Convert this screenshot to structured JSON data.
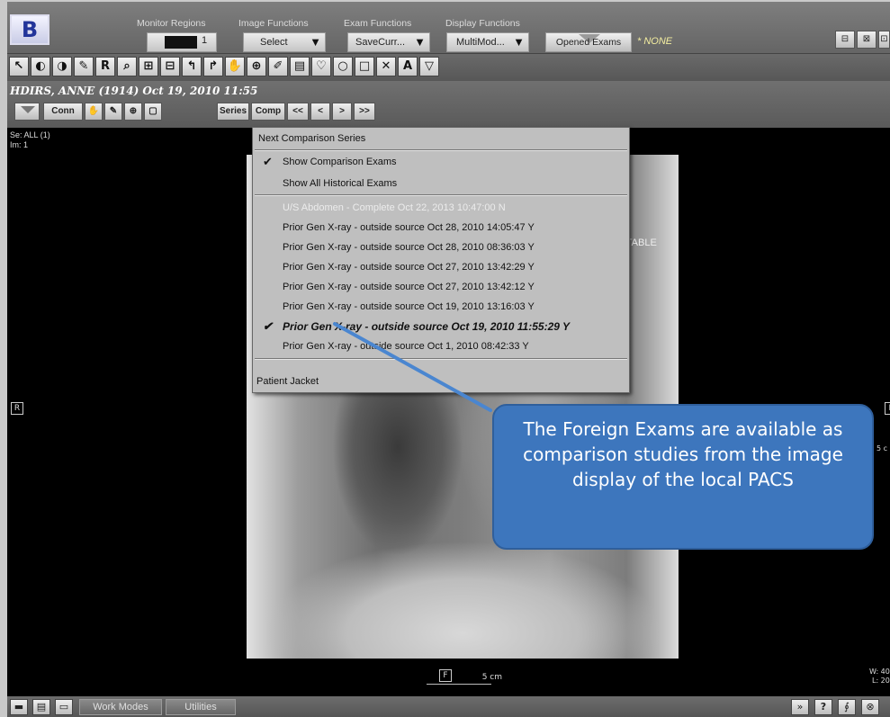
{
  "app": {
    "logo": "B"
  },
  "toolbar": {
    "monitor_regions_label": "Monitor Regions",
    "monitor_value": "1",
    "image_functions_label": "Image Functions",
    "image_functions_value": "Select",
    "exam_functions_label": "Exam Functions",
    "exam_functions_value": "SaveCurr...",
    "display_functions_label": "Display Functions",
    "display_functions_value": "MultiMod...",
    "opened_exams_label": "Opened Exams",
    "opened_exams_status": "* NONE",
    "dropdown_arrow": "▼"
  },
  "window_buttons": [
    "⊟",
    "⊠",
    "⊡"
  ],
  "tools": [
    "↖",
    "◐",
    "◑",
    "✎",
    "R",
    "⌕",
    "⊞",
    "⊟",
    "↰",
    "↱",
    "✋",
    "⊕",
    "✐",
    "▤",
    "♡",
    "○",
    "□",
    "✕",
    "A",
    "▽"
  ],
  "patient": {
    "header": "HDIRS, ANNE (1914) Oct 19, 2010 11:55",
    "conn_label": "Conn",
    "series_label": "Series",
    "comp_label": "Comp",
    "nav": [
      "<<",
      "<",
      ">",
      ">>"
    ]
  },
  "viewport": {
    "series_info": "Se: ALL (1)",
    "image_info": "Im: 1",
    "right_marker": "R",
    "left_marker": "L",
    "foot_marker": "F",
    "scale_bottom": "5 cm",
    "scale_right": "5 c",
    "window_width": "W: 40",
    "window_level": "L: 20",
    "portable_label": "RTABLE"
  },
  "comp_menu": {
    "items": [
      {
        "label": "Next Comparison Series",
        "checked": false,
        "disabled": false,
        "bold": false
      },
      {
        "label": "Show Comparison Exams",
        "checked": true,
        "disabled": false,
        "bold": false
      },
      {
        "label": "Show All Historical Exams",
        "checked": false,
        "disabled": false,
        "bold": false
      },
      {
        "label": "U/S Abdomen - Complete Oct 22, 2013 10:47:00 N",
        "checked": false,
        "disabled": true,
        "bold": false
      },
      {
        "label": "Prior Gen X-ray - outside source Oct 28, 2010 14:05:47 Y",
        "checked": false,
        "disabled": false,
        "bold": false
      },
      {
        "label": "Prior Gen X-ray - outside source Oct 28, 2010 08:36:03 Y",
        "checked": false,
        "disabled": false,
        "bold": false
      },
      {
        "label": "Prior Gen X-ray - outside source Oct 27, 2010 13:42:29 Y",
        "checked": false,
        "disabled": false,
        "bold": false
      },
      {
        "label": "Prior Gen X-ray - outside source Oct 27, 2010 13:42:12 Y",
        "checked": false,
        "disabled": false,
        "bold": false
      },
      {
        "label": "Prior Gen X-ray - outside source Oct 19, 2010 13:16:03 Y",
        "checked": false,
        "disabled": false,
        "bold": false
      },
      {
        "label": "Prior Gen X-ray - outside source Oct 19, 2010 11:55:29 Y",
        "checked": true,
        "disabled": false,
        "bold": true
      },
      {
        "label": "Prior Gen X-ray - outside source Oct 1, 2010 08:42:33 Y",
        "checked": false,
        "disabled": false,
        "bold": false
      },
      {
        "label": "Patient Jacket",
        "checked": false,
        "disabled": false,
        "bold": false
      }
    ],
    "check_glyph": "✔"
  },
  "callout": {
    "text": "The Foreign Exams are available as comparison studies from the image display of the local PACS",
    "color": "#3d76bd"
  },
  "bottombar": {
    "work_modes": "Work Modes",
    "utilities": "Utilities",
    "right_buttons": [
      "»",
      "?",
      "∮",
      "⊗"
    ]
  }
}
